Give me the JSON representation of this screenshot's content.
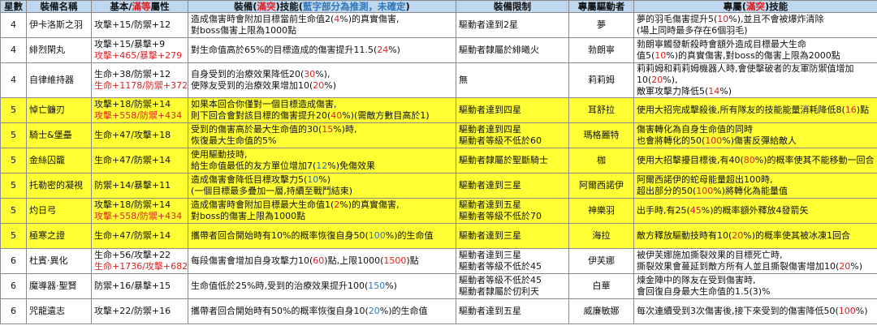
{
  "header": {
    "star": "星數",
    "name": "裝備名稱",
    "attr_prefix": "基本/",
    "attr_red": "滿等",
    "attr_suffix": "屬性",
    "eff_prefix": "裝備(",
    "eff_red": "滿突",
    "eff_mid": ")技能(",
    "eff_blue": "藍字部分為推測，未確定",
    "eff_suffix": ")",
    "limit": "裝備限制",
    "driver": "專屬驅動者",
    "excl_prefix": "專屬(",
    "excl_red": "滿突",
    "excl_suffix": ")技能"
  },
  "rows": [
    {
      "star": "4",
      "name": "伊卡洛斯之羽",
      "yellow": false,
      "attr": [
        [
          {
            "t": "攻擊+15/防禦+12"
          }
        ]
      ],
      "effect": [
        [
          {
            "t": "造成傷害時會附加目標當前生命值2("
          },
          {
            "t": "4",
            "c": "r"
          },
          {
            "t": "%)的真實傷害,"
          }
        ],
        [
          {
            "t": "對boss傷害上限為1000點"
          }
        ]
      ],
      "limit": [
        [
          {
            "t": "驅動者達到2星"
          }
        ]
      ],
      "driver": "夢",
      "excl": [
        [
          {
            "t": "夢的羽毛傷害提升5("
          },
          {
            "t": "10",
            "c": "r"
          },
          {
            "t": "%),並且不會被爆炸清除"
          }
        ],
        [
          {
            "t": "(場上同時最多存在6個羽毛)"
          }
        ]
      ]
    },
    {
      "star": "4",
      "name": "緋烈閑丸",
      "yellow": false,
      "attr": [
        [
          {
            "t": "攻擊+15/暴擊+9"
          }
        ],
        [
          {
            "t": "攻擊+465/暴擊+279",
            "c": "r"
          }
        ]
      ],
      "effect": [
        [
          {
            "t": "對生命值高於65%的目標造成的傷害提升11.5("
          },
          {
            "t": "24",
            "c": "r"
          },
          {
            "t": "%)"
          }
        ]
      ],
      "limit": [
        [
          {
            "t": "驅動者隸屬於緋曦火"
          }
        ]
      ],
      "driver": "勃朗寧",
      "excl": [
        [
          {
            "t": "勃朗寧觸發斬殺時會額外造成目標最大生命"
          }
        ],
        [
          {
            "t": "值5("
          },
          {
            "t": "10",
            "c": "r"
          },
          {
            "t": "%)的真實傷害,對boss的傷害上限為2000點"
          }
        ]
      ]
    },
    {
      "star": "4",
      "name": "自律維持器",
      "yellow": false,
      "attr": [
        [
          {
            "t": "生命+38/防禦+12"
          }
        ],
        [
          {
            "t": "生命+1178/防禦+372",
            "c": "r"
          }
        ]
      ],
      "effect": [
        [
          {
            "t": "自身受到的治療效果降低20("
          },
          {
            "t": "30",
            "c": "r"
          },
          {
            "t": "%),"
          }
        ],
        [
          {
            "t": "使隊友受到的治療效果增加10("
          },
          {
            "t": "20",
            "c": "r"
          },
          {
            "t": "%)"
          }
        ]
      ],
      "limit": [
        [
          {
            "t": "無"
          }
        ]
      ],
      "driver": "莉莉姆",
      "excl": [
        [
          {
            "t": "莉莉姆和莉莉姆機器人時,會使擊破者的友軍防禦值增加10("
          },
          {
            "t": "20",
            "c": "r"
          },
          {
            "t": "%),"
          }
        ],
        [
          {
            "t": "敵軍攻擊力降低5("
          },
          {
            "t": "14",
            "c": "r"
          },
          {
            "t": "%)"
          }
        ]
      ]
    },
    {
      "star": "5",
      "name": "悼亡鐮刃",
      "yellow": true,
      "attr": [
        [
          {
            "t": "攻擊+18/防禦+14"
          }
        ],
        [
          {
            "t": "攻擊+558/防禦+434",
            "c": "r"
          }
        ]
      ],
      "effect": [
        [
          {
            "t": "如果本回合你僅對一個目標造成傷害,"
          }
        ],
        [
          {
            "t": "則下回合會對該目標的傷害提升20("
          },
          {
            "t": "40",
            "c": "r"
          },
          {
            "t": "%)(需敵方數目高於1)"
          }
        ]
      ],
      "limit": [
        [
          {
            "t": "驅動者達到四星"
          }
        ]
      ],
      "driver": "耳舒拉",
      "excl": [
        [
          {
            "t": "使用大招完成擊殺後,所有隊友的技能能量消耗降低8("
          },
          {
            "t": "16",
            "c": "r"
          },
          {
            "t": ")點"
          }
        ]
      ]
    },
    {
      "star": "5",
      "name": "騎士&堡壘",
      "yellow": true,
      "attr": [
        [
          {
            "t": "生命+47/攻擊+18"
          }
        ]
      ],
      "effect": [
        [
          {
            "t": "受到的傷害高於最大生命值的30("
          },
          {
            "t": "15",
            "c": "r"
          },
          {
            "t": "%)時,"
          }
        ],
        [
          {
            "t": "恢復最大生命值的5%"
          }
        ]
      ],
      "limit": [
        [
          {
            "t": "驅動者達到四星"
          }
        ],
        [
          {
            "t": "驅動者等級不低於60"
          }
        ]
      ],
      "driver": "瑪格麗特",
      "excl": [
        [
          {
            "t": "傷害轉化為自身生命值的同時"
          }
        ],
        [
          {
            "t": "也會將轉化的50("
          },
          {
            "t": "100",
            "c": "r"
          },
          {
            "t": "%)傷害反彈給敵人"
          }
        ]
      ]
    },
    {
      "star": "5",
      "name": "金絲囚籠",
      "yellow": true,
      "attr": [
        [
          {
            "t": "生命+47/防禦+14"
          }
        ]
      ],
      "effect": [
        [
          {
            "t": "使用驅動技時,"
          }
        ],
        [
          {
            "t": "給生命值最低的友方單位增加7("
          },
          {
            "t": "12",
            "c": "b"
          },
          {
            "t": "%)免傷效果"
          }
        ]
      ],
      "limit": [
        [
          {
            "t": "驅動者隸屬於聖斷騎士"
          }
        ]
      ],
      "driver": "枷",
      "excl": [
        [
          {
            "t": "使用大招擊擾目標後,有40("
          },
          {
            "t": "80",
            "c": "r"
          },
          {
            "t": "%)的概率使其不能移動一回合"
          }
        ]
      ]
    },
    {
      "star": "5",
      "name": "托勒密的凝視",
      "yellow": true,
      "attr": [
        [
          {
            "t": "防禦+14/暴擊+11"
          }
        ]
      ],
      "effect": [
        [
          {
            "t": "造成傷害會降低目標攻擊力5("
          },
          {
            "t": "10",
            "c": "b"
          },
          {
            "t": "%)"
          }
        ],
        [
          {
            "t": "(一個目標最多疊加一層,持續至戰鬥結束)"
          }
        ]
      ],
      "limit": [
        [
          {
            "t": "驅動者達到三星"
          }
        ]
      ],
      "driver": "阿爾西諾伊",
      "excl": [
        [
          {
            "t": "阿爾西諾伊的蛇母能量超出100時,"
          }
        ],
        [
          {
            "t": "超出部分的50("
          },
          {
            "t": "100",
            "c": "r"
          },
          {
            "t": "%)將轉化為能量值"
          }
        ]
      ]
    },
    {
      "star": "5",
      "name": "灼日弓",
      "yellow": true,
      "attr": [
        [
          {
            "t": "攻擊+18/防禦+14"
          }
        ],
        [
          {
            "t": "攻擊+558/防禦+434",
            "c": "r"
          }
        ]
      ],
      "effect": [
        [
          {
            "t": "造成傷害時會附加目標最大生命值1("
          },
          {
            "t": "2",
            "c": "r"
          },
          {
            "t": "%)的真實傷害,"
          }
        ],
        [
          {
            "t": "對boss的傷害上限為1000點"
          }
        ]
      ],
      "limit": [
        [
          {
            "t": "驅動者達到五星"
          }
        ],
        [
          {
            "t": "驅動者等級不低於70"
          }
        ]
      ],
      "driver": "神樂羽",
      "excl": [
        [
          {
            "t": "出手時,有25("
          },
          {
            "t": "45",
            "c": "r"
          },
          {
            "t": "%)的概率額外釋放4發箭矢"
          }
        ]
      ]
    },
    {
      "star": "5",
      "name": "極寒之證",
      "yellow": true,
      "attr": [
        [
          {
            "t": "生命+47/防禦+14"
          }
        ]
      ],
      "effect": [
        [
          {
            "t": "攜帶者回合開始時有10%的概率恢復自身50("
          },
          {
            "t": "100",
            "c": "b"
          },
          {
            "t": "%)的生命值"
          }
        ]
      ],
      "limit": [
        [
          {
            "t": "驅動者達到三星"
          }
        ]
      ],
      "driver": "海拉",
      "excl": [
        [
          {
            "t": "敵方釋放驅動技時有10("
          },
          {
            "t": "20",
            "c": "r"
          },
          {
            "t": "%)的概率使其被冰凍1回合"
          }
        ]
      ]
    },
    {
      "star": "6",
      "name": "杜賓·異化",
      "yellow": false,
      "attr": [
        [
          {
            "t": "生命+56/攻擊+22"
          }
        ],
        [
          {
            "t": "生命+1736/攻擊+682",
            "c": "r"
          }
        ]
      ],
      "effect": [
        [
          {
            "t": "每段傷害會增加自身攻擊力10("
          },
          {
            "t": "60",
            "c": "r"
          },
          {
            "t": ")點,上限1000("
          },
          {
            "t": "1500",
            "c": "r"
          },
          {
            "t": ")點"
          }
        ]
      ],
      "limit": [
        [
          {
            "t": "驅動者達到三星"
          }
        ],
        [
          {
            "t": "驅動者等級不低於45"
          }
        ]
      ],
      "driver": "伊芙娜",
      "excl": [
        [
          {
            "t": "被伊芙娜施加撕裂效果的目標死亡時,"
          }
        ],
        [
          {
            "t": "撕裂效果會蔓延到敵方所有人並且撕裂傷害增加10("
          },
          {
            "t": "20",
            "c": "r"
          },
          {
            "t": "%)"
          }
        ]
      ]
    },
    {
      "star": "6",
      "name": "魔導器·聖賢",
      "yellow": false,
      "attr": [
        [
          {
            "t": "防禦+16/暴擊+15"
          }
        ]
      ],
      "effect": [
        [
          {
            "t": "生命值低於25%時,受到的治療效果提升100("
          },
          {
            "t": "150",
            "c": "b"
          },
          {
            "t": "%)"
          }
        ]
      ],
      "limit": [
        [
          {
            "t": "驅動者等級不低於45"
          }
        ],
        [
          {
            "t": "驅動者隸屬於仞利天"
          }
        ]
      ],
      "driver": "白華",
      "excl": [
        [
          {
            "t": "煉金陣中的隊友在受到傷害時,"
          }
        ],
        [
          {
            "t": "會回復自身最大生命值的1.5(3)%"
          }
        ]
      ]
    },
    {
      "star": "6",
      "name": "咒龍遺志",
      "yellow": false,
      "attr": [
        [
          {
            "t": "攻擊+22/防禦+16"
          }
        ]
      ],
      "effect": [
        [
          {
            "t": "攜帶者回合開始時有50%的概率恢復自身10("
          },
          {
            "t": "20",
            "c": "b"
          },
          {
            "t": "%)的生命值"
          }
        ]
      ],
      "limit": [
        [
          {
            "t": "驅動者達到五星"
          }
        ]
      ],
      "driver": "威廉敏娜",
      "excl": [
        [
          {
            "t": "每次連續受到3次傷害後,接下來受到的傷害降低50("
          },
          {
            "t": "100",
            "c": "r"
          },
          {
            "t": "%)"
          }
        ]
      ]
    }
  ]
}
